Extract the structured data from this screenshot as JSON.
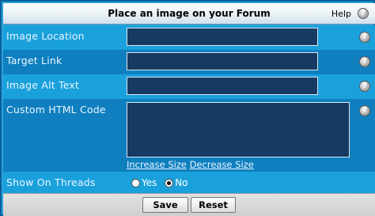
{
  "header": {
    "title": "Place an image on your Forum",
    "help_label": "Help",
    "help_glyph": "?"
  },
  "fields": {
    "image_location": {
      "label": "Image Location",
      "value": ""
    },
    "target_link": {
      "label": "Target Link",
      "value": ""
    },
    "image_alt_text": {
      "label": "Image Alt Text",
      "value": ""
    },
    "custom_html": {
      "label": "Custom HTML Code",
      "value": "",
      "increase_label": "Increase Size",
      "decrease_label": "Decrease Size"
    },
    "show_on_threads": {
      "label": "Show On Threads",
      "options": [
        "Yes",
        "No"
      ],
      "selected": "No"
    }
  },
  "buttons": {
    "save": "Save",
    "reset": "Reset"
  },
  "icons": {
    "help": "help-icon",
    "radio": "radio-icon"
  },
  "colors": {
    "header_bg": "#e9f1f7",
    "row_light": "#1aa1dc",
    "row_dark": "#0f7fbf",
    "input_bg": "#173a63",
    "footer_bg": "#d9d9d9"
  }
}
